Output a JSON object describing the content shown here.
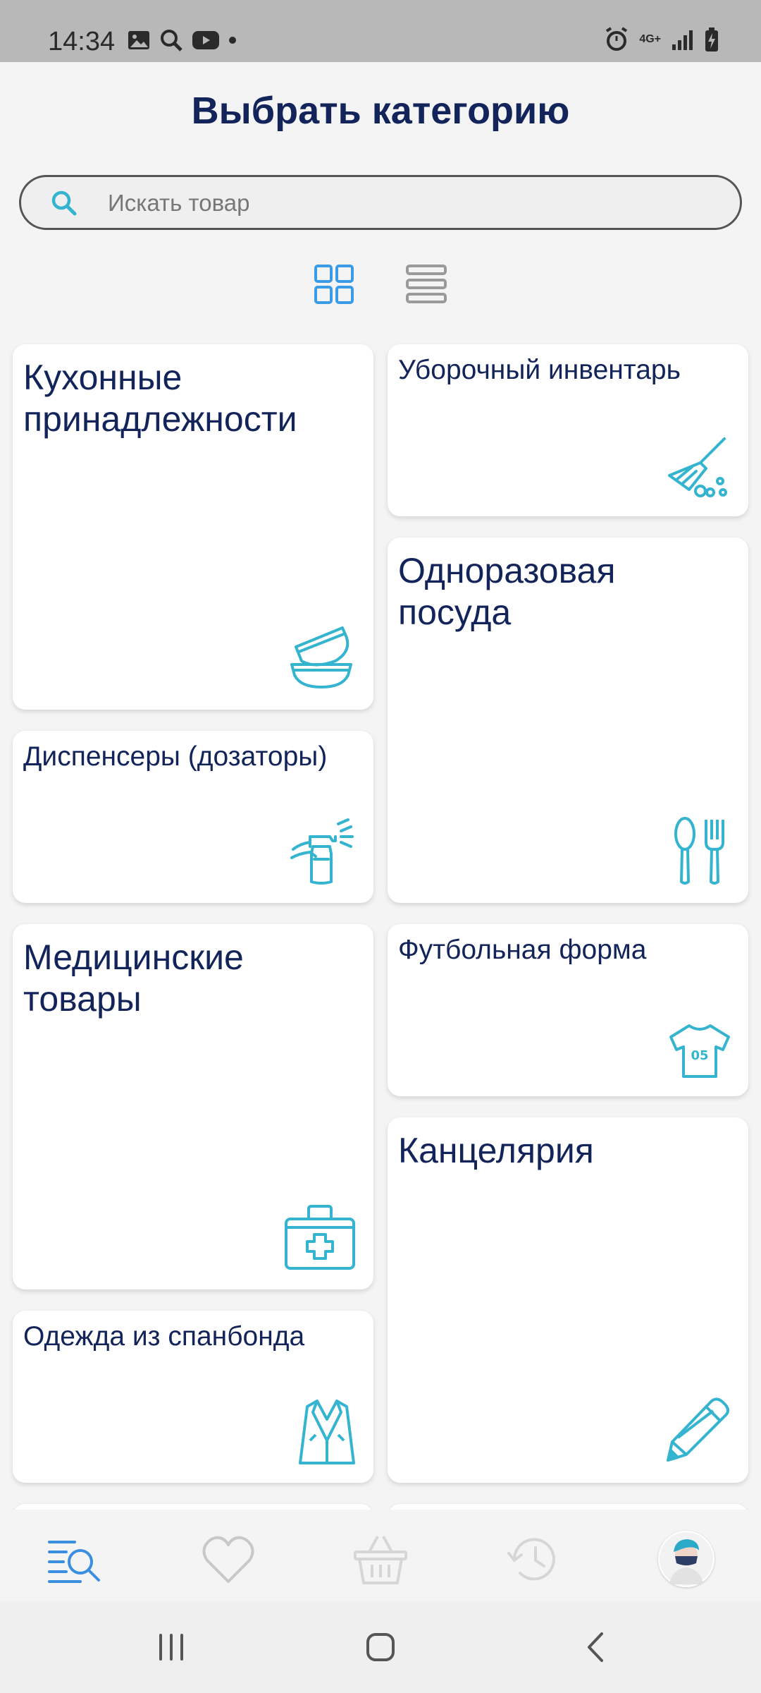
{
  "status_bar": {
    "time": "14:34",
    "network": "4G+"
  },
  "header": {
    "title": "Выбрать категорию"
  },
  "search": {
    "placeholder": "Искать товар"
  },
  "categories": [
    {
      "label": "Кухонные принадлежности",
      "icon": "bowls-icon"
    },
    {
      "label": "Уборочный инвентарь",
      "icon": "broom-icon"
    },
    {
      "label": "Одноразовая посуда",
      "icon": "cutlery-icon"
    },
    {
      "label": "Диспенсеры (дозаторы)",
      "icon": "spray-bottle-icon"
    },
    {
      "label": "Медицинские товары",
      "icon": "first-aid-kit-icon"
    },
    {
      "label": "Футбольная форма",
      "icon": "jersey-icon"
    },
    {
      "label": "Канцелярия",
      "icon": "pencil-icon"
    },
    {
      "label": "Одежда из спанбонда",
      "icon": "robe-icon"
    }
  ],
  "jersey_number": "05",
  "colors": {
    "accent": "#35b4cf",
    "title": "#12245a",
    "active_nav": "#3a8fe0",
    "inactive_nav": "#c8c8c8"
  }
}
